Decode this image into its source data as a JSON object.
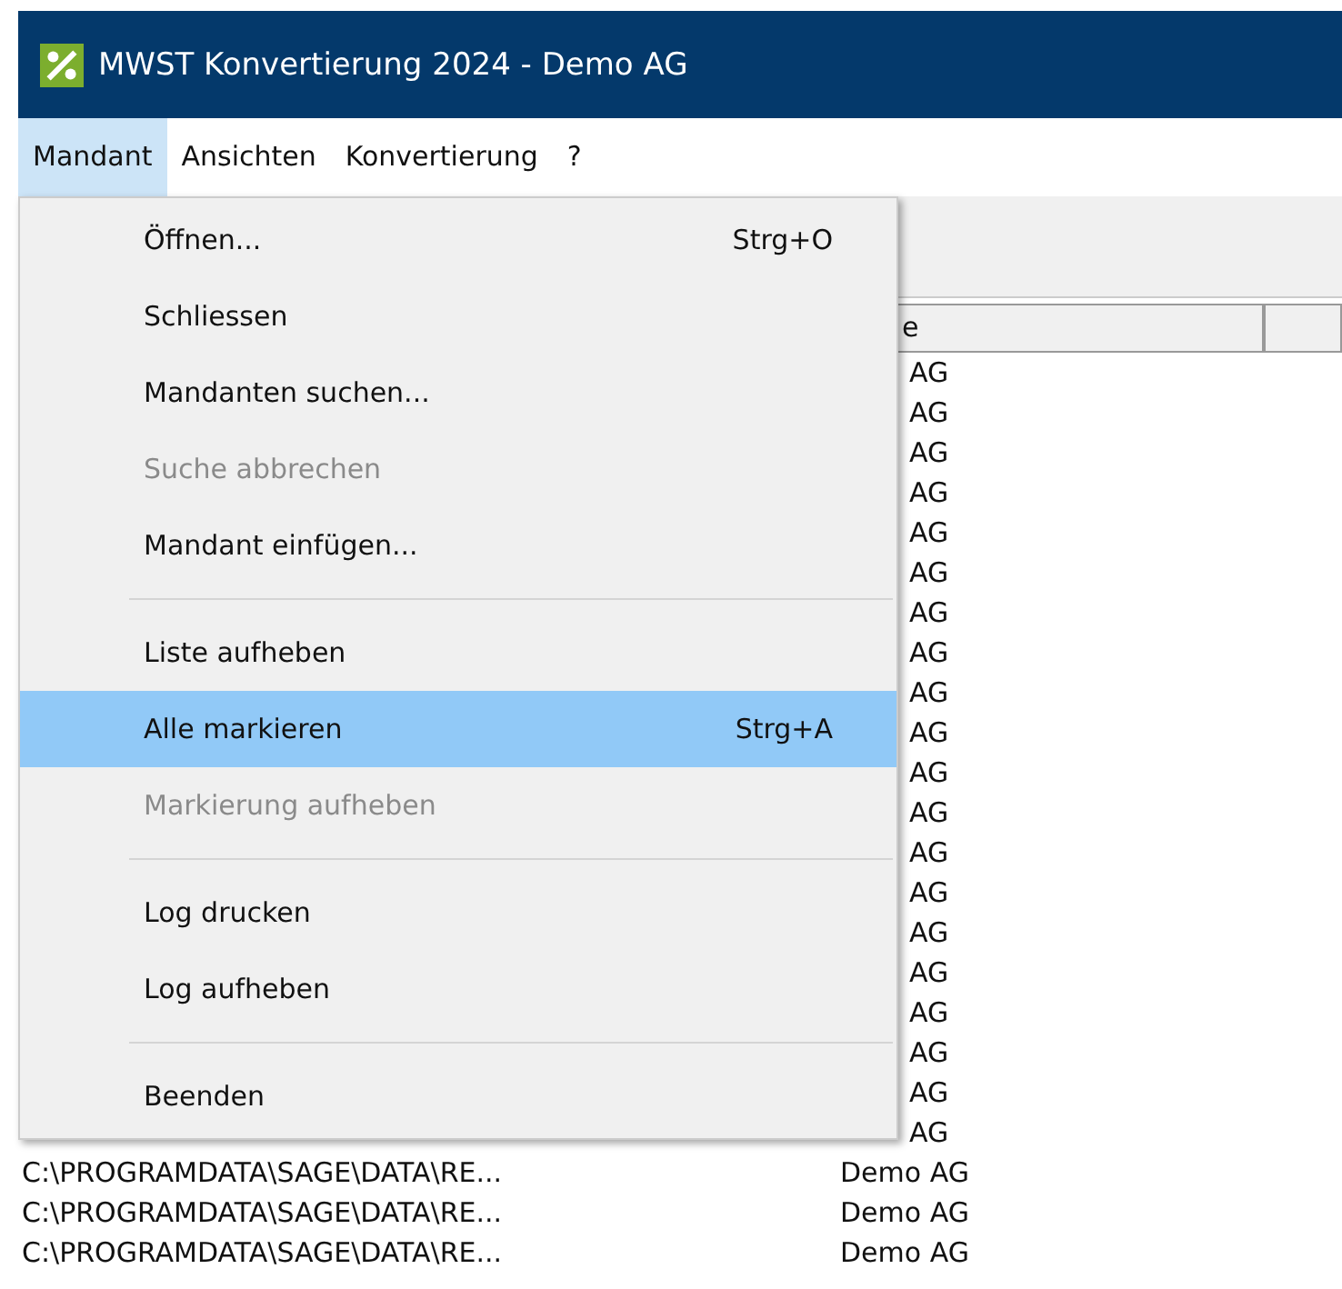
{
  "window": {
    "title": "MWST Konvertierung 2024 - Demo AG"
  },
  "menubar": [
    {
      "label": "Mandant",
      "selected": true
    },
    {
      "label": "Ansichten",
      "selected": false
    },
    {
      "label": "Konvertierung",
      "selected": false
    },
    {
      "label": "?",
      "selected": false
    }
  ],
  "dropdown": [
    {
      "kind": "item",
      "label": "Öffnen...",
      "shortcut": "Strg+O",
      "disabled": false,
      "selected": false
    },
    {
      "kind": "item",
      "label": "Schliessen",
      "disabled": false,
      "selected": false
    },
    {
      "kind": "item",
      "label": "Mandanten suchen...",
      "disabled": false,
      "selected": false
    },
    {
      "kind": "item",
      "label": "Suche abbrechen",
      "disabled": true,
      "selected": false
    },
    {
      "kind": "item",
      "label": "Mandant einfügen...",
      "disabled": false,
      "selected": false
    },
    {
      "kind": "separator"
    },
    {
      "kind": "item",
      "label": "Liste aufheben",
      "disabled": false,
      "selected": false
    },
    {
      "kind": "item",
      "label": "Alle markieren",
      "shortcut": "Strg+A",
      "disabled": false,
      "selected": true
    },
    {
      "kind": "item",
      "label": "Markierung aufheben",
      "disabled": true,
      "selected": false
    },
    {
      "kind": "separator"
    },
    {
      "kind": "item",
      "label": "Log drucken",
      "disabled": false,
      "selected": false
    },
    {
      "kind": "item",
      "label": "Log aufheben",
      "disabled": false,
      "selected": false
    },
    {
      "kind": "separator"
    },
    {
      "kind": "item",
      "label": "Beenden",
      "disabled": false,
      "selected": false
    }
  ],
  "table": {
    "columns": [
      {
        "label": "e"
      },
      {}
    ],
    "rows": [
      {
        "kind": "covered",
        "company": "AG"
      },
      {
        "kind": "covered",
        "company": "AG"
      },
      {
        "kind": "covered",
        "company": "AG"
      },
      {
        "kind": "covered",
        "company": "AG"
      },
      {
        "kind": "covered",
        "company": "AG"
      },
      {
        "kind": "covered",
        "company": "AG"
      },
      {
        "kind": "covered",
        "company": "AG"
      },
      {
        "kind": "covered",
        "company": "AG"
      },
      {
        "kind": "covered",
        "company": "AG"
      },
      {
        "kind": "covered",
        "company": "AG"
      },
      {
        "kind": "covered",
        "company": "AG"
      },
      {
        "kind": "covered",
        "company": "AG"
      },
      {
        "kind": "covered",
        "company": "AG"
      },
      {
        "kind": "covered",
        "company": "AG"
      },
      {
        "kind": "covered",
        "company": "AG"
      },
      {
        "kind": "covered",
        "company": "AG"
      },
      {
        "kind": "covered",
        "company": "AG"
      },
      {
        "kind": "covered",
        "company": "AG"
      },
      {
        "kind": "covered",
        "company": "AG"
      },
      {
        "kind": "covered",
        "company": "AG"
      },
      {
        "kind": "full",
        "path": "C:\\PROGRAMDATA\\SAGE\\DATA\\RE...",
        "company": "Demo AG"
      },
      {
        "kind": "full",
        "path": "C:\\PROGRAMDATA\\SAGE\\DATA\\RE...",
        "company": "Demo AG"
      },
      {
        "kind": "full",
        "path": "C:\\PROGRAMDATA\\SAGE\\DATA\\RE...",
        "company": "Demo AG"
      }
    ]
  }
}
